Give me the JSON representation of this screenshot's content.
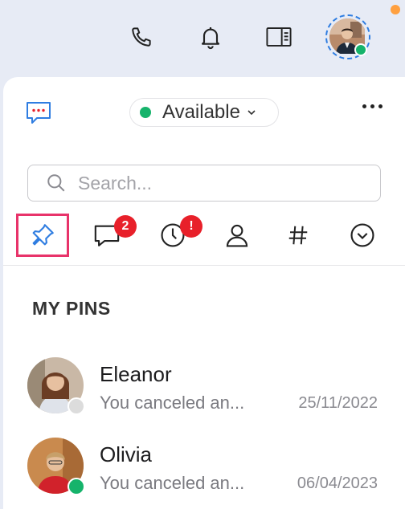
{
  "header": {
    "icons": [
      "phone-icon",
      "bell-icon",
      "panel-toggle-icon"
    ],
    "user_status_color": "#16b36b",
    "notification_dot_color": "#ffa040"
  },
  "toolbar": {
    "status_label": "Available",
    "status_color": "#16b36b"
  },
  "search": {
    "placeholder": "Search..."
  },
  "tabs": [
    {
      "name": "pins",
      "icon": "pin-icon",
      "active": true,
      "badge": ""
    },
    {
      "name": "chats",
      "icon": "chat-bubble-icon",
      "active": false,
      "badge": "2"
    },
    {
      "name": "recents",
      "icon": "clock-icon",
      "active": false,
      "badge": "!"
    },
    {
      "name": "contacts",
      "icon": "person-icon",
      "active": false,
      "badge": ""
    },
    {
      "name": "channels",
      "icon": "hash-icon",
      "active": false,
      "badge": ""
    },
    {
      "name": "more",
      "icon": "chevron-down-circle-icon",
      "active": false,
      "badge": ""
    }
  ],
  "section": {
    "title": "MY PINS"
  },
  "pins": [
    {
      "name": "Eleanor",
      "preview": "You canceled an...",
      "date": "25/11/2022",
      "presence": "offline"
    },
    {
      "name": "Olivia",
      "preview": "You canceled an...",
      "date": "06/04/2023",
      "presence": "online"
    }
  ],
  "colors": {
    "accent": "#2f7de1",
    "badge": "#e8202a",
    "active_tab_outline": "#e8336a"
  }
}
